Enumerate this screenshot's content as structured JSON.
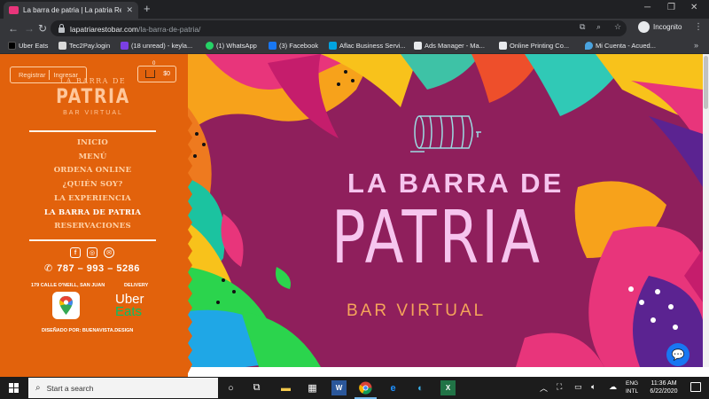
{
  "browser": {
    "tab_title": "La barra de patria | La patria Resto",
    "url_host": "lapatriarestobar.com",
    "url_path": "/la-barra-de-patria/",
    "profile_label": "Incognito",
    "bookmarks": [
      {
        "label": "Uber Eats",
        "color": "#000000"
      },
      {
        "label": "Tec2Pay.login",
        "color": "#d9d9d9"
      },
      {
        "label": "(18 unread) - keyla...",
        "color": "#7b3fe4"
      },
      {
        "label": "(1) WhatsApp",
        "color": "#25d366"
      },
      {
        "label": "(3) Facebook",
        "color": "#1877f2"
      },
      {
        "label": "Aflac Business Servi...",
        "color": "#00a3e0"
      },
      {
        "label": "Ads Manager - Ma...",
        "color": "#e8eaed"
      },
      {
        "label": "Online Printing Co...",
        "color": "#e8eaed"
      },
      {
        "label": "Mi Cuenta - Acued...",
        "color": "#4aa3df"
      }
    ]
  },
  "site": {
    "auth": {
      "register": "Registrar",
      "login": "Ingresar"
    },
    "cart": {
      "count": "0",
      "total": "$0"
    },
    "logo": {
      "top": "LA BARRA DE",
      "main": "PATRIA",
      "sub": "BAR VIRTUAL"
    },
    "nav": [
      {
        "label": "INICIO",
        "active": false
      },
      {
        "label": "MENÚ",
        "active": false
      },
      {
        "label": "ORDENA ONLINE",
        "active": false
      },
      {
        "label": "¿QUIÉN SOY?",
        "active": false
      },
      {
        "label": "LA EXPERIENCIA",
        "active": false
      },
      {
        "label": "LA BARRA DE PATRIA",
        "active": true
      },
      {
        "label": "RESERVACIONES",
        "active": false
      }
    ],
    "phone": "787 – 993 – 5286",
    "address": "179 CALLE O'NEILL, SAN JUAN",
    "delivery_label": "DELIVERY",
    "uber_line1": "Uber",
    "uber_line2": "Eats",
    "designer": "DISEÑADO POR: BUENAVISTA.DESIGN",
    "hero": {
      "line1": "LA BARRA DE",
      "line2": "PATRIA",
      "line3": "BAR VIRTUAL"
    },
    "colors": {
      "sidebar": "#e2620c",
      "hero_bg": "#8f1f5c",
      "hero_text": "#f6c5ee",
      "accent": "#f5a55a"
    }
  },
  "taskbar": {
    "search_placeholder": "Start a search",
    "lang_top": "ENG",
    "lang_bottom": "INTL",
    "time": "11:36 AM",
    "date": "6/22/2020"
  }
}
